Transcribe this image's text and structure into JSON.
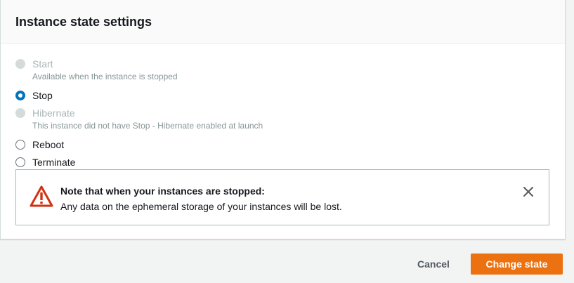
{
  "dialog": {
    "title": "Instance state settings"
  },
  "options": [
    {
      "label": "Start",
      "description": "Available when the instance is stopped",
      "disabled": true,
      "checked": false
    },
    {
      "label": "Stop",
      "description": "",
      "disabled": false,
      "checked": true
    },
    {
      "label": "Hibernate",
      "description": "This instance did not have Stop - Hibernate enabled at launch",
      "disabled": true,
      "checked": false
    },
    {
      "label": "Reboot",
      "description": "",
      "disabled": false,
      "checked": false
    },
    {
      "label": "Terminate",
      "description": "",
      "disabled": false,
      "checked": false
    }
  ],
  "alert": {
    "title": "Note that when your instances are stopped:",
    "message": "Any data on the ephemeral storage of your instances will be lost.",
    "icon": "warning-icon",
    "color": "#d13212"
  },
  "footer": {
    "cancel_label": "Cancel",
    "submit_label": "Change state"
  },
  "colors": {
    "accent": "#0073bb",
    "primary_button": "#ec7211"
  }
}
